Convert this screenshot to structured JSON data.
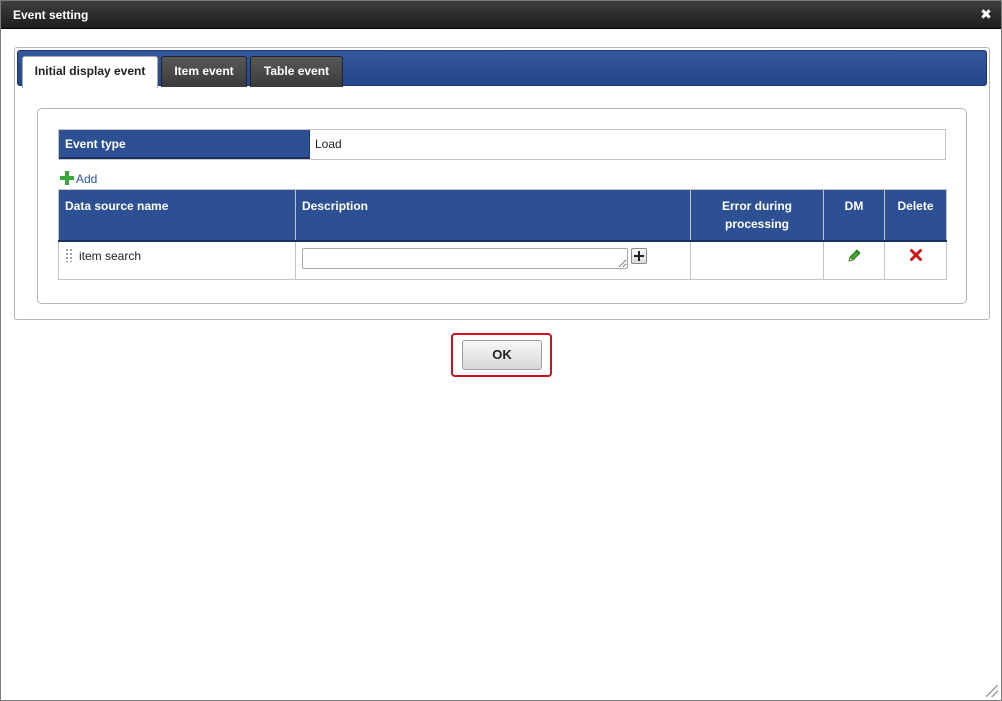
{
  "dialog": {
    "title": "Event setting",
    "close_glyph": "✖"
  },
  "tabs": [
    {
      "label": "Initial display event",
      "active": true
    },
    {
      "label": "Item event",
      "active": false
    },
    {
      "label": "Table event",
      "active": false
    }
  ],
  "event_type": {
    "label": "Event type",
    "value": "Load"
  },
  "add_link": {
    "label": "Add",
    "icon": "plus-icon"
  },
  "table": {
    "columns": [
      "Data source name",
      "Description",
      "Error during processing",
      "DM",
      "Delete"
    ],
    "rows": [
      {
        "data_source_name": "item search",
        "description": "",
        "error_during_processing": "",
        "dm_icon": "pencil-icon",
        "delete_icon": "delete-x-icon"
      }
    ]
  },
  "ok_button": {
    "label": "OK"
  },
  "colors": {
    "header_blue": "#2d4f94",
    "highlight_red": "#d0101a",
    "add_green": "#3aa73a",
    "delete_red": "#cc1a1a"
  }
}
